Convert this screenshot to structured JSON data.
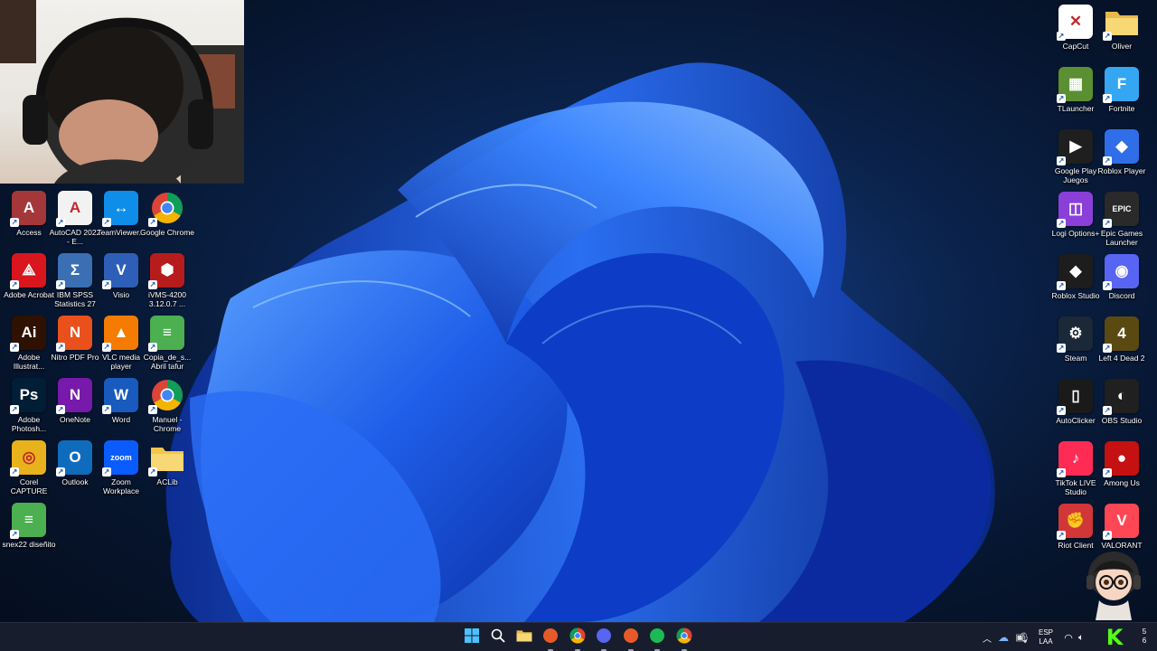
{
  "desktop": {
    "left_icons": [
      {
        "label": "Access",
        "icon": "access-icon",
        "color": "#a4373a",
        "glyph": "A"
      },
      {
        "label": "AutoCAD 2022 - E...",
        "icon": "autocad-icon",
        "color": "#f2f2f2",
        "glyph": "A"
      },
      {
        "label": "TeamViewer...",
        "icon": "teamviewer-icon",
        "color": "#0e8ee9",
        "glyph": "↔"
      },
      {
        "label": "Google Chrome",
        "icon": "chrome-icon",
        "color": "#ffffff",
        "glyph": ""
      },
      {
        "label": "Adobe Acrobat",
        "icon": "acrobat-icon",
        "color": "#d9161e",
        "glyph": "⟁"
      },
      {
        "label": "IBM SPSS Statistics 27",
        "icon": "spss-icon",
        "color": "#3a6fb4",
        "glyph": "Σ"
      },
      {
        "label": "Visio",
        "icon": "visio-icon",
        "color": "#2e5fb8",
        "glyph": "V"
      },
      {
        "label": "iVMS-4200 3.12.0.7 ...",
        "icon": "ivms-icon",
        "color": "#b71c1c",
        "glyph": "⬢"
      },
      {
        "label": "Adobe Illustrat...",
        "icon": "illustrator-icon",
        "color": "#2f1100",
        "glyph": "Ai"
      },
      {
        "label": "Nitro PDF Pro",
        "icon": "nitro-icon",
        "color": "#e9501c",
        "glyph": "N"
      },
      {
        "label": "VLC media player",
        "icon": "vlc-icon",
        "color": "#f57c00",
        "glyph": "▲"
      },
      {
        "label": "Copia_de_s... Abril tafur",
        "icon": "document-icon",
        "color": "#4caf50",
        "glyph": "≡"
      },
      {
        "label": "Adobe Photosh...",
        "icon": "photoshop-icon",
        "color": "#001e36",
        "glyph": "Ps"
      },
      {
        "label": "OneNote",
        "icon": "onenote-icon",
        "color": "#7719aa",
        "glyph": "N"
      },
      {
        "label": "Word",
        "icon": "word-icon",
        "color": "#185abd",
        "glyph": "W"
      },
      {
        "label": "Manuel - Chrome",
        "icon": "chrome-profile-icon",
        "color": "#ffffff",
        "glyph": ""
      },
      {
        "label": "Corel CAPTURE",
        "icon": "corel-capture-icon",
        "color": "#e8b21c",
        "glyph": "◎"
      },
      {
        "label": "Outlook",
        "icon": "outlook-icon",
        "color": "#0f6cbd",
        "glyph": "O"
      },
      {
        "label": "Zoom Workplace",
        "icon": "zoom-icon",
        "color": "#0b5cff",
        "glyph": "zoom"
      },
      {
        "label": "ACLib",
        "icon": "folder-icon",
        "color": "#f3c64b",
        "glyph": ""
      },
      {
        "label": "snex22 diseñito",
        "icon": "document-icon",
        "color": "#4caf50",
        "glyph": "≡"
      }
    ],
    "right_icons": [
      {
        "label": "CapCut",
        "icon": "capcut-icon",
        "color": "#ffffff",
        "glyph": "✕"
      },
      {
        "label": "Oliver",
        "icon": "folder-icon",
        "color": "#e9b949",
        "glyph": ""
      },
      {
        "label": "TLauncher",
        "icon": "tlauncher-icon",
        "color": "#5a8f32",
        "glyph": "▦"
      },
      {
        "label": "Fortnite",
        "icon": "fortnite-icon",
        "color": "#35a7f2",
        "glyph": "F"
      },
      {
        "label": "Google Play Juegos",
        "icon": "google-play-games-icon",
        "color": "#1f1f1f",
        "glyph": "▶"
      },
      {
        "label": "Roblox Player",
        "icon": "roblox-icon",
        "color": "#2f6ee8",
        "glyph": "◆"
      },
      {
        "label": "Logi Options+",
        "icon": "logi-icon",
        "color": "#8b3fd9",
        "glyph": "◫"
      },
      {
        "label": "Epic Games Launcher",
        "icon": "epic-games-icon",
        "color": "#2a2a2a",
        "glyph": "EPIC"
      },
      {
        "label": "Roblox Studio",
        "icon": "roblox-studio-icon",
        "color": "#1d1d1d",
        "glyph": "◆"
      },
      {
        "label": "Discord",
        "icon": "discord-icon",
        "color": "#5865f2",
        "glyph": "◉"
      },
      {
        "label": "Steam",
        "icon": "steam-icon",
        "color": "#1b2838",
        "glyph": "⚙"
      },
      {
        "label": "Left 4 Dead 2",
        "icon": "left4dead-icon",
        "color": "#5a4a12",
        "glyph": "4"
      },
      {
        "label": "AutoClicker",
        "icon": "autoclicker-icon",
        "color": "#1a1a1a",
        "glyph": "▯"
      },
      {
        "label": "OBS Studio",
        "icon": "obs-icon",
        "color": "#202020",
        "glyph": "◐"
      },
      {
        "label": "TikTok LIVE Studio",
        "icon": "tiktok-live-icon",
        "color": "#fe2c55",
        "glyph": "♪"
      },
      {
        "label": "Among Us",
        "icon": "among-us-icon",
        "color": "#c51111",
        "glyph": "●"
      },
      {
        "label": "Riot Client",
        "icon": "riot-client-icon",
        "color": "#d13639",
        "glyph": "✊"
      },
      {
        "label": "VALORANT",
        "icon": "valorant-icon",
        "color": "#ff4655",
        "glyph": "V"
      }
    ]
  },
  "taskbar": {
    "apps": [
      {
        "name": "start-button",
        "icon": "windows-logo-icon"
      },
      {
        "name": "search-button",
        "icon": "search-icon"
      },
      {
        "name": "file-explorer-button",
        "icon": "file-explorer-icon"
      },
      {
        "name": "pinned-app-button",
        "icon": "app-icon"
      },
      {
        "name": "chrome-taskbar-button",
        "icon": "chrome-icon"
      },
      {
        "name": "discord-taskbar-button",
        "icon": "discord-icon"
      },
      {
        "name": "pinned-app-2-button",
        "icon": "app-icon"
      },
      {
        "name": "spotify-taskbar-button",
        "icon": "spotify-icon"
      },
      {
        "name": "chrome-profile-taskbar-button",
        "icon": "chrome-icon"
      }
    ],
    "tray": {
      "language_top": "ESP",
      "language_bottom": "LAA",
      "clock_fragment_top": "5",
      "clock_fragment_bottom": "6"
    }
  },
  "overlay": {
    "streamer_badge_letter": "K"
  }
}
